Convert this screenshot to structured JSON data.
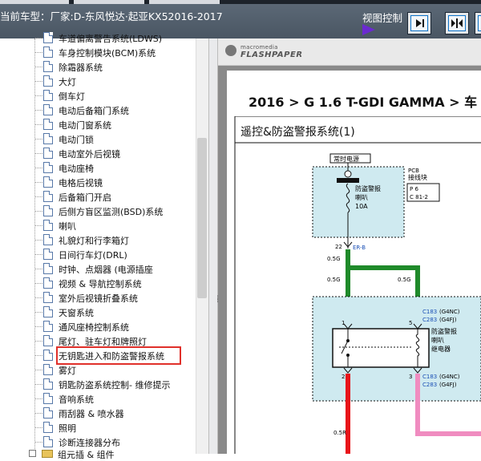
{
  "header": {
    "vehicle_text": "当前车型：厂家:D-东风悦达·起亚KX52016-2017",
    "view_control_label": "视图控制"
  },
  "tree": {
    "partial_top": "车道偏离警告系统(LDWS)",
    "items": [
      "车身控制模块(BCM)系统",
      "除霜器系统",
      "大灯",
      "倒车灯",
      "电动后备箱门系统",
      "电动门窗系统",
      "电动门锁",
      "电动室外后视镜",
      "电动座椅",
      "电格后视镜",
      "后备箱门开启",
      "后侧方盲区监测(BSD)系统",
      "喇叭",
      "礼貌灯和行李箱灯",
      "日间行车灯(DRL)",
      "时钟、点烟器 (电源插座",
      "视频 & 导航控制系统",
      "室外后视镜折叠系统",
      "天窗系统",
      "通风座椅控制系统",
      "尾灯、驻车灯和牌照灯",
      "无钥匙进入和防盗警报系统",
      "雾灯",
      "钥匙防盗系统控制- 维修提示",
      "音响系统",
      "雨刮器 & 喷水器",
      "照明",
      "诊断连接器分布"
    ],
    "partial_bottom": "组元插 & 组件"
  },
  "viewer": {
    "logo_small": "macromedia",
    "logo_big": "FLASHPAPER",
    "doc_title": "2016 > G 1.6 T-GDI GAMMA > 车",
    "system_title": "遥控&防盗警报系统(1)"
  },
  "diagram": {
    "power_label": "常时电源",
    "pcb_label_1": "PCB",
    "pcb_label_2": "接线块",
    "fuse_name_1": "防盗警报",
    "fuse_name_2": "喇叭",
    "fuse_rating": "10A",
    "pin_ref_1": "P 6",
    "pin_ref_2": "C 81-2",
    "pin_22": "22",
    "wire_er_b": "ER-B",
    "wire_05g_a": "0.5G",
    "wire_05g_b": "0.5G",
    "wire_05g_c": "0.5G",
    "c183_top": "C183",
    "g4nc_top": "(G4NC)",
    "c283_top": "C283",
    "g4fj_top": "(G4FJ)",
    "relay_1": "防盗警报",
    "relay_2": "喇叭",
    "relay_3": "继电器",
    "pin_1": "1",
    "pin_5": "5",
    "pin_2": "2",
    "pin_3": "3",
    "c183_bot": "C183",
    "g4nc_bot": "(G4NC)",
    "c283_bot": "C283",
    "g4fj_bot": "(G4FJ)",
    "wire_05r": "0.5R"
  },
  "colors": {
    "toolbar": "#55616e",
    "selection_outline": "#e0302a",
    "wire_green": "#1f8a2a",
    "wire_red": "#e8141a",
    "wire_pink": "#f08cc0",
    "module_fill": "#cfeaf0",
    "connector_blue": "#1a4fb5"
  }
}
